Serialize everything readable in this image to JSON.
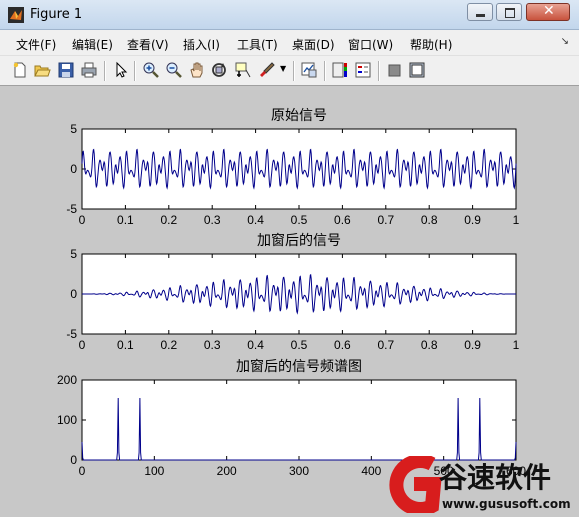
{
  "window": {
    "title": "Figure 1"
  },
  "menu": [
    "文件(F)",
    "编辑(E)",
    "查看(V)",
    "插入(I)",
    "工具(T)",
    "桌面(D)",
    "窗口(W)",
    "帮助(H)"
  ],
  "toolbar_icons": [
    "new-figure-icon",
    "open-file-icon",
    "save-icon",
    "print-icon",
    "pointer-icon",
    "zoom-in-icon",
    "zoom-out-icon",
    "pan-icon",
    "rotate-3d-icon",
    "data-cursor-icon",
    "brush-icon",
    "brush-dropdown-icon",
    "link-plot-icon",
    "colorbar-icon",
    "legend-icon",
    "hide-plot-tools-icon",
    "show-plot-tools-icon"
  ],
  "watermark": {
    "brand": "谷速软件",
    "url": "www.gususoft.com"
  },
  "chart_data": [
    {
      "type": "line",
      "title": "原始信号",
      "xlim": [
        0,
        1
      ],
      "ylim": [
        -5,
        5
      ],
      "xticks": [
        "0",
        "0.1",
        "0.2",
        "0.3",
        "0.4",
        "0.5",
        "0.6",
        "0.7",
        "0.8",
        "0.9",
        "1"
      ],
      "yticks": [
        "5",
        "0",
        "-5"
      ],
      "series": [
        {
          "color": "#00008b",
          "description_amplitude": 2.5
        }
      ]
    },
    {
      "type": "line",
      "title": "加窗后的信号",
      "xlim": [
        0,
        1
      ],
      "ylim": [
        -5,
        5
      ],
      "xticks": [
        "0",
        "0.1",
        "0.2",
        "0.3",
        "0.4",
        "0.5",
        "0.6",
        "0.7",
        "0.8",
        "0.9",
        "1"
      ],
      "yticks": [
        "5",
        "0",
        "-5"
      ],
      "series": [
        {
          "color": "#00008b"
        }
      ]
    },
    {
      "type": "line",
      "title": "加窗后的信号频谱图",
      "xlim": [
        0,
        600
      ],
      "ylim": [
        0,
        200
      ],
      "xticks": [
        "0",
        "100",
        "200",
        "300",
        "400",
        "500",
        "600"
      ],
      "yticks": [
        "200",
        "100",
        "0"
      ],
      "peaks": [
        {
          "x": 0,
          "y": 45
        },
        {
          "x": 50,
          "y": 155
        },
        {
          "x": 80,
          "y": 155
        },
        {
          "x": 520,
          "y": 155
        },
        {
          "x": 550,
          "y": 155
        },
        {
          "x": 600,
          "y": 45
        }
      ],
      "series": [
        {
          "color": "#00008b"
        }
      ]
    }
  ]
}
